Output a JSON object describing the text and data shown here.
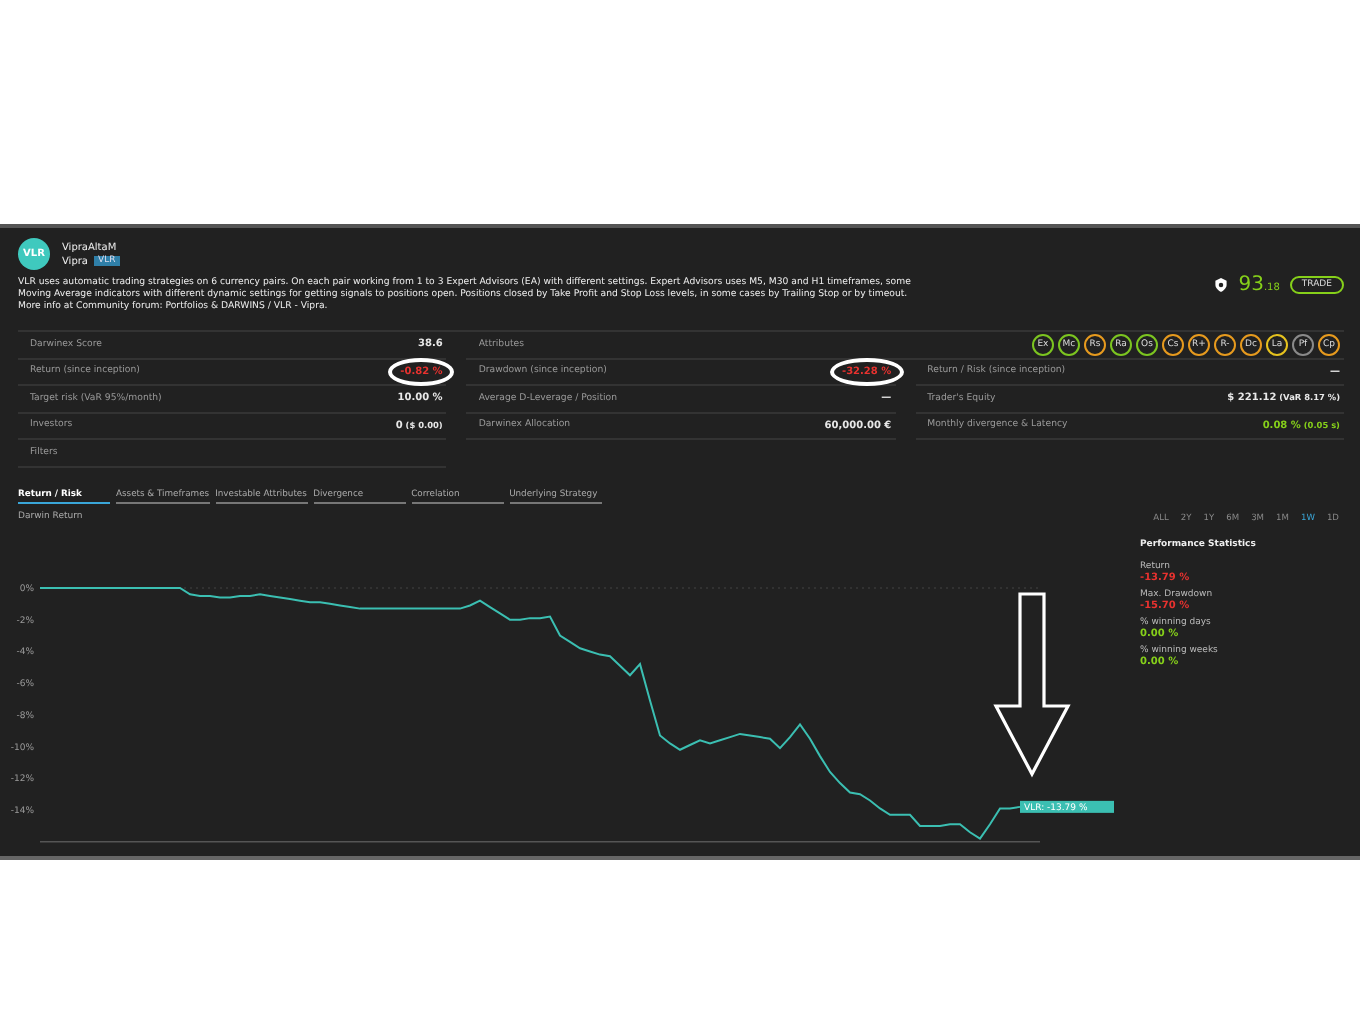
{
  "profile": {
    "avatar": "VLR",
    "name": "VipraAltaM",
    "owner": "Vipra",
    "tag": "VLR",
    "description": "VLR uses automatic trading strategies on 6 currency pairs. On each pair working from 1 to 3 Expert Advisors (EA) with different settings. Expert Advisors uses M5, M30 and H1 timeframes, some Moving Average indicators with different dynamic settings for getting signals to positions open. Positions closed by Take Profit and Stop Loss levels, in some cases by Trailing Stop or by timeout. More info at Community forum: Portfolios & DARWINS / VLR - Vipra.",
    "score_main": "93",
    "score_decimals": ".18",
    "trade_button": "TRADE"
  },
  "stats": [
    {
      "label": "Darwinex Score",
      "value": "38.6"
    },
    {
      "label": "Attributes",
      "kind": "attributes",
      "items": [
        {
          "label": "Ex",
          "color": "#7cc520"
        },
        {
          "label": "Mc",
          "color": "#7cc520"
        },
        {
          "label": "Rs",
          "color": "#e69a1e"
        },
        {
          "label": "Ra",
          "color": "#7cc520"
        },
        {
          "label": "Os",
          "color": "#7cc520"
        },
        {
          "label": "Cs",
          "color": "#e69a1e"
        },
        {
          "label": "R+",
          "color": "#e69a1e"
        },
        {
          "label": "R-",
          "color": "#e69a1e"
        },
        {
          "label": "Dc",
          "color": "#e69a1e"
        },
        {
          "label": "La",
          "color": "#e6c21e"
        },
        {
          "label": "Pf",
          "color": "#8a8a8a"
        },
        {
          "label": "Cp",
          "color": "#e69a1e"
        }
      ]
    },
    {
      "label": "Return (since inception)",
      "value": "-0.82 %",
      "color": "#e8322f",
      "circled": true
    },
    {
      "label": "Drawdown (since inception)",
      "value": "-32.28 %",
      "color": "#e8322f",
      "circled": true
    },
    {
      "label": "Return / Risk (since inception)",
      "value": "—"
    },
    {
      "label": "Target risk (VaR 95%/month)",
      "value": "10.00 %"
    },
    {
      "label": "Average D-Leverage / Position",
      "value": "—"
    },
    {
      "label": "Trader's Equity",
      "value": "$ 221.12",
      "note": "(VaR 8.17 %)"
    },
    {
      "label": "Investors",
      "value": "0",
      "note": "($ 0.00)"
    },
    {
      "label": "Darwinex Allocation",
      "value": "60,000.00 €"
    },
    {
      "label": "Monthly divergence & Latency",
      "value": "0.08 %",
      "note": "(0.05 s)",
      "color": "#86d01a"
    },
    {
      "label": "Filters"
    }
  ],
  "tabs": [
    {
      "label": "Return / Risk",
      "selected": true
    },
    {
      "label": "Assets & Timeframes",
      "selected": false
    },
    {
      "label": "Investable Attributes",
      "selected": false
    },
    {
      "label": "Divergence",
      "selected": false
    },
    {
      "label": "Correlation",
      "selected": false
    },
    {
      "label": "Underlying Strategy",
      "selected": false
    }
  ],
  "chart_title": "Darwin Return",
  "ranges": [
    {
      "label": "ALL",
      "selected": false
    },
    {
      "label": "2Y",
      "selected": false
    },
    {
      "label": "1Y",
      "selected": false
    },
    {
      "label": "6M",
      "selected": false
    },
    {
      "label": "3M",
      "selected": false
    },
    {
      "label": "1M",
      "selected": false
    },
    {
      "label": "1W",
      "selected": true
    },
    {
      "label": "1D",
      "selected": false
    }
  ],
  "chart_data": {
    "type": "line",
    "ylim": [
      -16,
      0
    ],
    "yticks": [
      {
        "value": 0,
        "label": "0%"
      },
      {
        "value": -2,
        "label": "-2%"
      },
      {
        "value": -4,
        "label": "-4%"
      },
      {
        "value": -6,
        "label": "-6%"
      },
      {
        "value": -8,
        "label": "-8%"
      },
      {
        "value": -10,
        "label": "-10%"
      },
      {
        "value": -12,
        "label": "-12%"
      },
      {
        "value": -14,
        "label": "-14%"
      }
    ],
    "series": [
      {
        "color": "#3bbfb2",
        "values": [
          0,
          0,
          0,
          0,
          0,
          0,
          0,
          0,
          0,
          0,
          0,
          0,
          0,
          0,
          0,
          -0.4,
          -0.5,
          -0.5,
          -0.6,
          -0.6,
          -0.5,
          -0.5,
          -0.4,
          -0.5,
          -0.6,
          -0.7,
          -0.8,
          -0.9,
          -0.9,
          -1.0,
          -1.1,
          -1.2,
          -1.3,
          -1.3,
          -1.3,
          -1.3,
          -1.3,
          -1.3,
          -1.3,
          -1.3,
          -1.3,
          -1.3,
          -1.3,
          -1.1,
          -0.8,
          -1.2,
          -1.6,
          -2.0,
          -2.0,
          -1.9,
          -1.9,
          -1.8,
          -3.0,
          -3.4,
          -3.8,
          -4.0,
          -4.2,
          -4.3,
          -4.9,
          -5.5,
          -4.8,
          -7.1,
          -9.3,
          -9.8,
          -10.2,
          -9.9,
          -9.6,
          -9.8,
          -9.6,
          -9.4,
          -9.2,
          -9.3,
          -9.4,
          -9.5,
          -10.1,
          -9.4,
          -8.6,
          -9.5,
          -10.6,
          -11.6,
          -12.3,
          -12.9,
          -13.0,
          -13.4,
          -13.9,
          -14.3,
          -14.3,
          -14.3,
          -15.0,
          -15.0,
          -15.0,
          -14.9,
          -14.9,
          -15.4,
          -15.8,
          -14.9,
          -13.9,
          -13.9,
          -13.8
        ]
      }
    ],
    "annotations": [
      "VLR: -13.79 %"
    ]
  },
  "performance": {
    "title": "Performance Statistics",
    "items": [
      {
        "label": "Return",
        "value": "-13.79 %",
        "color": "#e8322f"
      },
      {
        "label": "Max. Drawdown",
        "value": "-15.70 %",
        "color": "#e8322f"
      },
      {
        "label": "% winning days",
        "value": "0.00 %",
        "color": "#86d01a"
      },
      {
        "label": "% winning weeks",
        "value": "0.00 %",
        "color": "#86d01a"
      }
    ]
  }
}
